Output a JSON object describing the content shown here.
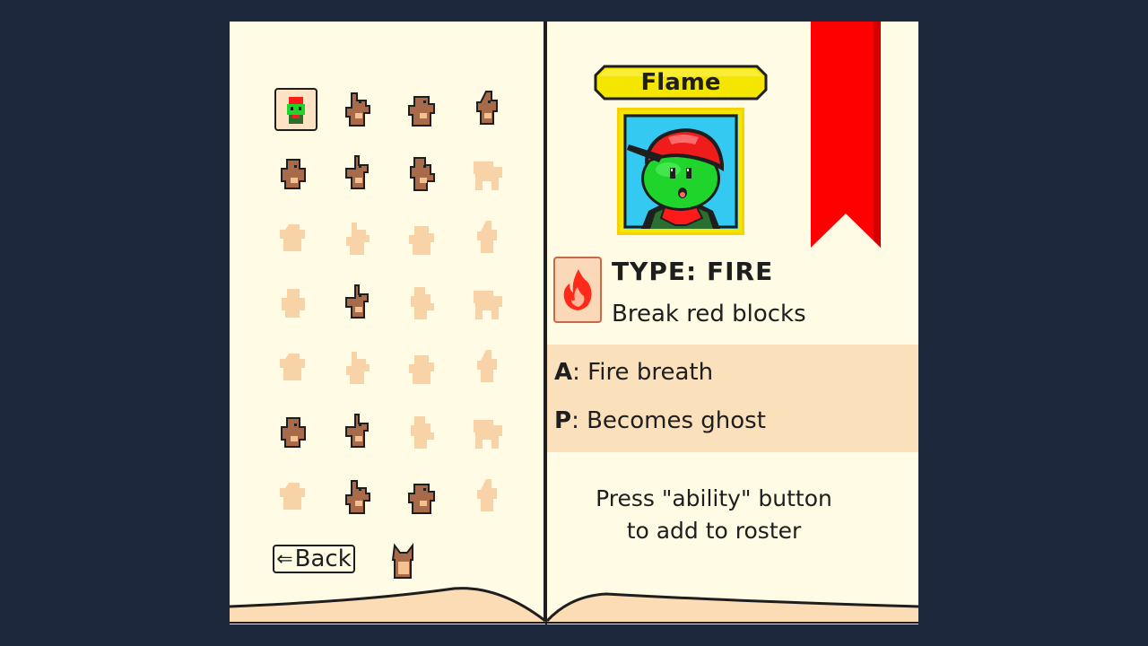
{
  "creature_name": "Flame",
  "type_label": "TYPE: FIRE",
  "type_description": "Break red blocks",
  "abilities": [
    {
      "key": "A",
      "sep": ":",
      "text": "Fire breath"
    },
    {
      "key": "P",
      "sep": ":",
      "text": "Becomes ghost"
    }
  ],
  "hint": {
    "line1": "Press \"ability\" button",
    "line2": "to add to roster"
  },
  "back_button": {
    "arrow": "⇐",
    "label": "Back"
  },
  "colors": {
    "background": "#1e283c",
    "page": "#fffbe4",
    "ribbon": "#ff0000",
    "banner": "#f5e600",
    "unlocked_creature": "#a86a48",
    "locked_silhouette": "#f8d3a8",
    "ability_band": "#fbe0bc"
  },
  "roster": [
    {
      "icon": "player-frog-icon",
      "state": "selected"
    },
    {
      "icon": "weasel-icon",
      "state": "unlocked"
    },
    {
      "icon": "squirrel-icon",
      "state": "unlocked"
    },
    {
      "icon": "horned-beast-icon",
      "state": "unlocked"
    },
    {
      "icon": "owl-icon",
      "state": "unlocked"
    },
    {
      "icon": "rabbit-icon",
      "state": "unlocked"
    },
    {
      "icon": "bird-icon",
      "state": "unlocked"
    },
    {
      "icon": "horse-silhouette-icon",
      "state": "locked"
    },
    {
      "icon": "bug-silhouette-icon",
      "state": "locked"
    },
    {
      "icon": "ghost-silhouette-icon",
      "state": "locked"
    },
    {
      "icon": "orb-silhouette-icon",
      "state": "locked"
    },
    {
      "icon": "dino-silhouette-icon",
      "state": "locked"
    },
    {
      "icon": "serpent-silhouette-icon",
      "state": "locked"
    },
    {
      "icon": "monkey-icon",
      "state": "unlocked"
    },
    {
      "icon": "cat-silhouette-icon",
      "state": "locked"
    },
    {
      "icon": "dragon-silhouette-icon",
      "state": "locked"
    },
    {
      "icon": "cow-silhouette-icon",
      "state": "locked"
    },
    {
      "icon": "dinosaur-silhouette-icon",
      "state": "locked"
    },
    {
      "icon": "seal-silhouette-icon",
      "state": "locked"
    },
    {
      "icon": "wolf-silhouette-icon",
      "state": "locked"
    },
    {
      "icon": "otter-icon",
      "state": "unlocked"
    },
    {
      "icon": "lion-icon",
      "state": "unlocked"
    },
    {
      "icon": "mole-silhouette-icon",
      "state": "locked"
    },
    {
      "icon": "ghost-blob-silhouette-icon",
      "state": "locked"
    },
    {
      "icon": "crab-silhouette-icon",
      "state": "locked"
    },
    {
      "icon": "pot-creature-icon",
      "state": "unlocked"
    },
    {
      "icon": "knight-icon",
      "state": "unlocked"
    },
    {
      "icon": "fish-silhouette-icon",
      "state": "locked"
    }
  ],
  "extra_creature": {
    "icon": "fox-icon",
    "state": "unlocked"
  }
}
